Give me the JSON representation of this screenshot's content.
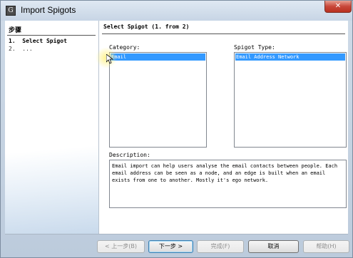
{
  "window": {
    "title": "Import Spigots",
    "icon": "app-icon",
    "close_label": "✕"
  },
  "sidebar": {
    "header": "步骤",
    "steps": [
      {
        "label": "1.  Select Spigot"
      },
      {
        "label": "2.  ..."
      }
    ]
  },
  "main": {
    "title": "Select Spigot (1. from 2)",
    "category": {
      "label": "Category:",
      "items": [
        "Email"
      ],
      "selected": "Email"
    },
    "spigot_type": {
      "label": "Spigot Type:",
      "items": [
        "Email Address Network"
      ],
      "selected": "Email Address Network"
    },
    "description": {
      "label": "Description:",
      "text": "Email import can help users analyse the email contacts between people. Each email address can be seen as a node, and an edge is built when an email exists from one to another. Mostly it's ego network."
    }
  },
  "buttons": {
    "back": "< 上一步(B)",
    "next": "下一步 >",
    "finish": "完成(F)",
    "cancel": "取消",
    "help": "帮助(H)"
  },
  "colors": {
    "selection": "#3399ff",
    "window_frame": "#c7d5e5"
  }
}
